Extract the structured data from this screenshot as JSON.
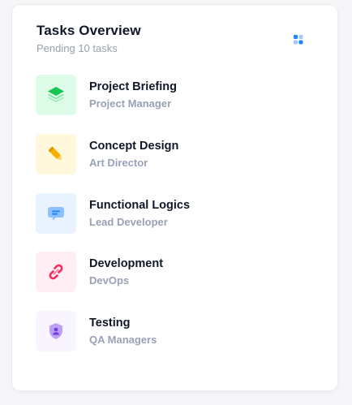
{
  "card": {
    "title": "Tasks Overview",
    "subtitle": "Pending 10 tasks",
    "menu_icon": "dots-grid-icon"
  },
  "tasks": [
    {
      "title": "Project Briefing",
      "subtitle": "Project Manager",
      "icon": "layers-icon",
      "bg": "#dcfce7",
      "color": "#17c653"
    },
    {
      "title": "Concept Design",
      "subtitle": "Art Director",
      "icon": "pencil-icon",
      "bg": "#fff8dd",
      "color": "#f6b100"
    },
    {
      "title": "Functional Logics",
      "subtitle": "Lead Developer",
      "icon": "message-icon",
      "bg": "#e9f3ff",
      "color": "#1b84ff"
    },
    {
      "title": "Development",
      "subtitle": "DevOps",
      "icon": "link-icon",
      "bg": "#ffeef3",
      "color": "#f8285a"
    },
    {
      "title": "Testing",
      "subtitle": "QA Managers",
      "icon": "shield-user-icon",
      "bg": "#f8f5ff",
      "color": "#7239ea"
    }
  ]
}
